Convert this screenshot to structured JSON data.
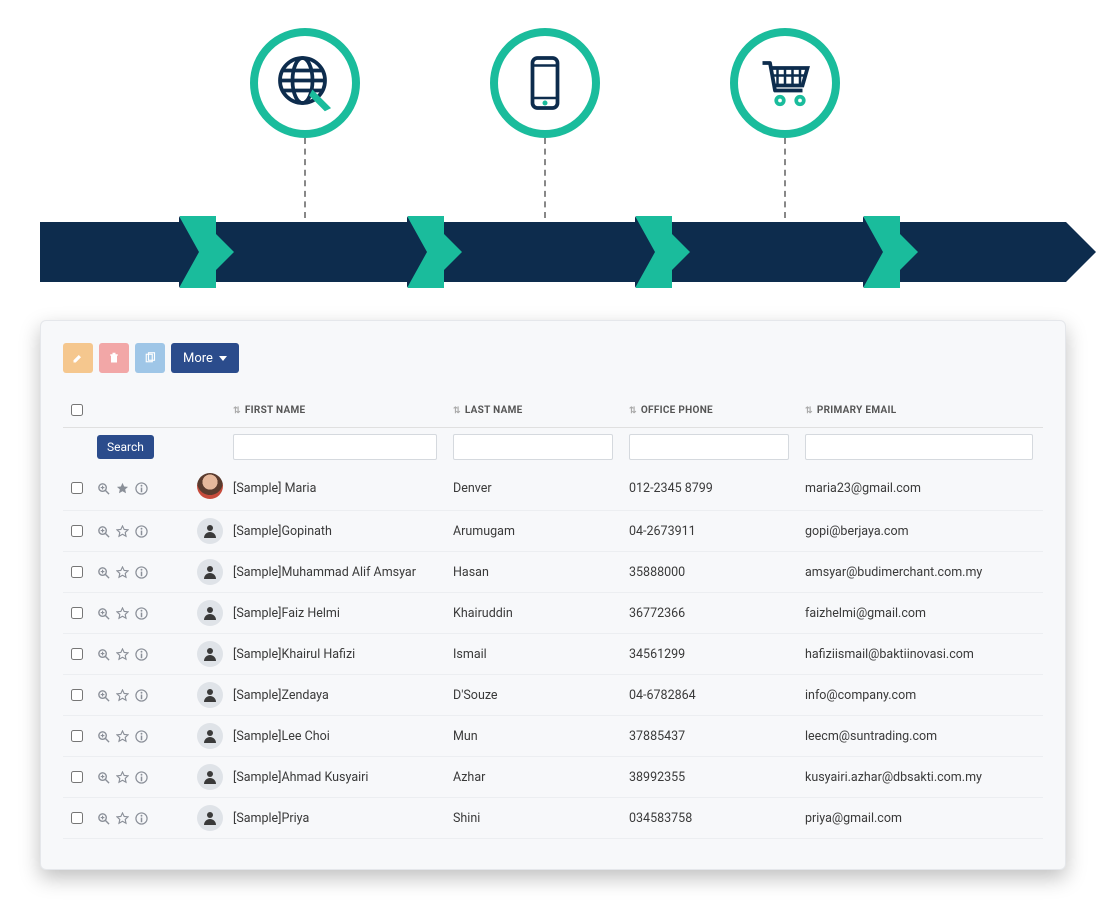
{
  "diagram": {
    "icons": [
      "globe-icon",
      "phone-icon",
      "cart-icon"
    ]
  },
  "toolbar": {
    "more_label": "More"
  },
  "search_button": "Search",
  "columns": {
    "first_name": "FIRST NAME",
    "last_name": "LAST NAME",
    "office_phone": "OFFICE PHONE",
    "primary_email": "PRIMARY EMAIL"
  },
  "rows": [
    {
      "first_name": "[Sample] Maria",
      "last_name": "Denver",
      "office_phone": "012-2345 8799",
      "primary_email": "maria23@gmail.com",
      "starred": true,
      "has_photo": true
    },
    {
      "first_name": "[Sample]Gopinath",
      "last_name": "Arumugam",
      "office_phone": "04-2673911",
      "primary_email": "gopi@berjaya.com",
      "starred": false,
      "has_photo": false
    },
    {
      "first_name": "[Sample]Muhammad Alif Amsyar",
      "last_name": "Hasan",
      "office_phone": "35888000",
      "primary_email": "amsyar@budimerchant.com.my",
      "starred": false,
      "has_photo": false
    },
    {
      "first_name": "[Sample]Faiz Helmi",
      "last_name": "Khairuddin",
      "office_phone": "36772366",
      "primary_email": "faizhelmi@gmail.com",
      "starred": false,
      "has_photo": false
    },
    {
      "first_name": "[Sample]Khairul Hafizi",
      "last_name": "Ismail",
      "office_phone": "34561299",
      "primary_email": "hafiziismail@baktiinovasi.com",
      "starred": false,
      "has_photo": false
    },
    {
      "first_name": "[Sample]Zendaya",
      "last_name": "D'Souze",
      "office_phone": "04-6782864",
      "primary_email": "info@company.com",
      "starred": false,
      "has_photo": false
    },
    {
      "first_name": "[Sample]Lee Choi",
      "last_name": "Mun",
      "office_phone": "37885437",
      "primary_email": "leecm@suntrading.com",
      "starred": false,
      "has_photo": false
    },
    {
      "first_name": "[Sample]Ahmad Kusyairi",
      "last_name": "Azhar",
      "office_phone": "38992355",
      "primary_email": "kusyairi.azhar@dbsakti.com.my",
      "starred": false,
      "has_photo": false
    },
    {
      "first_name": "[Sample]Priya",
      "last_name": "Shini",
      "office_phone": "034583758",
      "primary_email": "priya@gmail.com",
      "starred": false,
      "has_photo": false
    }
  ]
}
